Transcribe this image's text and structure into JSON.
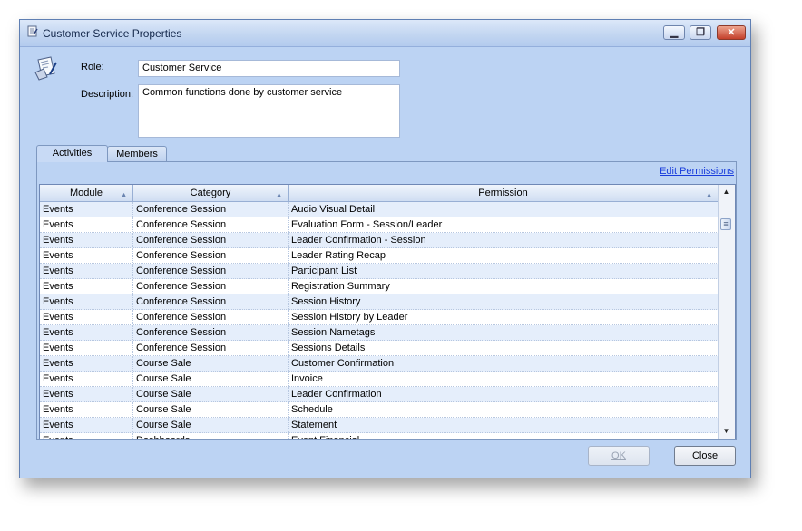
{
  "window": {
    "title": "Customer Service Properties",
    "icon": "role-properties-icon",
    "controls": {
      "minimize": "▁",
      "restore": "❐",
      "close": "✕"
    }
  },
  "form": {
    "role_label": "Role:",
    "role_value": "Customer Service",
    "description_label": "Description:",
    "description_value": "Common functions done by customer service"
  },
  "tabs": [
    {
      "label": "Activities",
      "active": true
    },
    {
      "label": "Members",
      "active": false
    }
  ],
  "edit_permissions_label": "Edit Permissions",
  "grid": {
    "columns": [
      "Module",
      "Category",
      "Permission"
    ],
    "rows": [
      [
        "Events",
        "Conference Session",
        "Audio Visual Detail"
      ],
      [
        "Events",
        "Conference Session",
        "Evaluation Form - Session/Leader"
      ],
      [
        "Events",
        "Conference Session",
        "Leader Confirmation - Session"
      ],
      [
        "Events",
        "Conference Session",
        "Leader Rating Recap"
      ],
      [
        "Events",
        "Conference Session",
        "Participant List"
      ],
      [
        "Events",
        "Conference Session",
        "Registration Summary"
      ],
      [
        "Events",
        "Conference Session",
        "Session History"
      ],
      [
        "Events",
        "Conference Session",
        "Session History by Leader"
      ],
      [
        "Events",
        "Conference Session",
        "Session Nametags"
      ],
      [
        "Events",
        "Conference Session",
        "Sessions Details"
      ],
      [
        "Events",
        "Course Sale",
        "Customer Confirmation"
      ],
      [
        "Events",
        "Course Sale",
        "Invoice"
      ],
      [
        "Events",
        "Course Sale",
        "Leader Confirmation"
      ],
      [
        "Events",
        "Course Sale",
        "Schedule"
      ],
      [
        "Events",
        "Course Sale",
        "Statement"
      ],
      [
        "Events",
        "Dashboards",
        "Event Financial"
      ]
    ]
  },
  "buttons": {
    "ok": "OK",
    "close": "Close"
  },
  "colors": {
    "window_bg": "#bcd3f3",
    "link": "#1a3ddc",
    "alt_row": "#e5eefb"
  }
}
